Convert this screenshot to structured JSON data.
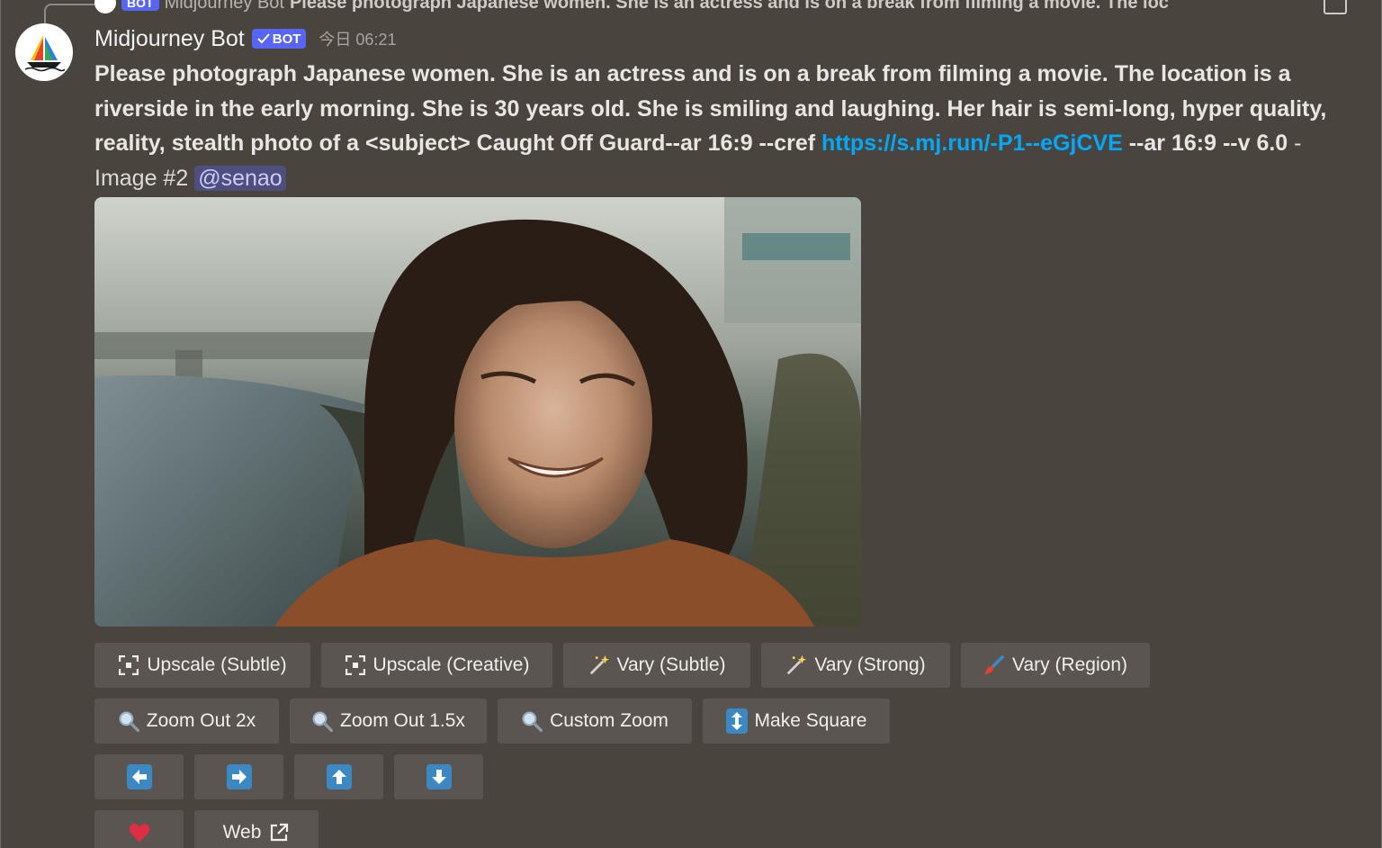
{
  "reply": {
    "bot_tag": "BOT",
    "author": "Midjourney Bot",
    "text": "Please photograph Japanese women. She is an actress and is on a break from filming a movie. The loc"
  },
  "message": {
    "author": "Midjourney Bot",
    "bot_badge": "BOT",
    "timestamp": "今日 06:21",
    "prompt": "Please photograph Japanese women. She is an actress and is on a break from filming a movie. The location is a riverside in the early morning. She is 30 years old. She is smiling and laughing. Her hair is semi-long, hyper quality, reality, stealth photo of a <subject> Caught Off Guard--ar 16:9 --cref",
    "link": "https://s.mj.run/-P1--eGjCVE",
    "prompt_tail": " --ar 16:9 --v 6.0",
    "suffix": " - Image #2 ",
    "mention": "@senao"
  },
  "buttons": {
    "row1": [
      {
        "label": "Upscale (Subtle)",
        "icon": "expand-icon"
      },
      {
        "label": "Upscale (Creative)",
        "icon": "expand-icon"
      },
      {
        "label": "Vary (Subtle)",
        "icon": "magic-wand-icon"
      },
      {
        "label": "Vary (Strong)",
        "icon": "magic-wand-icon"
      },
      {
        "label": "Vary (Region)",
        "icon": "paintbrush-icon"
      }
    ],
    "row2": [
      {
        "label": "Zoom Out 2x",
        "icon": "magnifier-icon"
      },
      {
        "label": "Zoom Out 1.5x",
        "icon": "magnifier-icon"
      },
      {
        "label": "Custom Zoom",
        "icon": "magnifier-icon"
      },
      {
        "label": "Make Square",
        "icon": "up-down-arrow-icon"
      }
    ],
    "row3": [
      "arrow-left-icon",
      "arrow-right-icon",
      "arrow-up-icon",
      "arrow-down-icon"
    ],
    "row4": [
      {
        "label": "",
        "icon": "heart-icon"
      },
      {
        "label": "Web",
        "icon": "external-link-icon"
      }
    ]
  },
  "colors": {
    "background": "#4a443f",
    "button": "#5a5550",
    "accent": "#5865f2",
    "link": "#00a8fc"
  }
}
